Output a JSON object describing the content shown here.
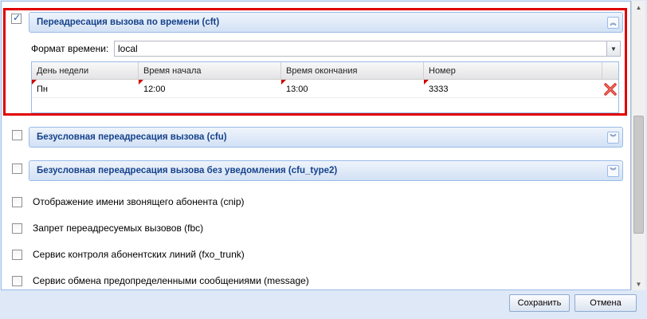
{
  "cft": {
    "title": "Переадресация вызова по времени (cft)",
    "checked": true,
    "format_label": "Формат времени:",
    "format_value": "local",
    "columns": [
      "День недели",
      "Время начала",
      "Время окончания",
      "Номер"
    ],
    "rows": [
      {
        "day": "Пн",
        "start": "12:00",
        "end": "13:00",
        "number": "3333"
      }
    ]
  },
  "panels": [
    {
      "title": "Безусловная переадресация вызова (cfu)"
    },
    {
      "title": "Безусловная переадресация вызова без уведомления (cfu_type2)"
    }
  ],
  "services": [
    {
      "label": "Отображение имени звонящего абонента (cnip)"
    },
    {
      "label": "Запрет переадресуемых вызовов (fbc)"
    },
    {
      "label": "Сервис контроля абонентских линий (fxo_trunk)"
    },
    {
      "label": "Сервис обмена предопределенными сообщениями (message)"
    }
  ],
  "footer": {
    "save_label": "Сохранить",
    "cancel_label": "Отмена"
  },
  "icons": {
    "collapse": "chevron-up-double-icon",
    "expand": "chevron-down-double-icon",
    "delete": "red-x-delete-icon",
    "dropdown": "chevron-down-icon"
  },
  "colors": {
    "highlight_border": "#e00000",
    "panel_title": "#15428b"
  }
}
